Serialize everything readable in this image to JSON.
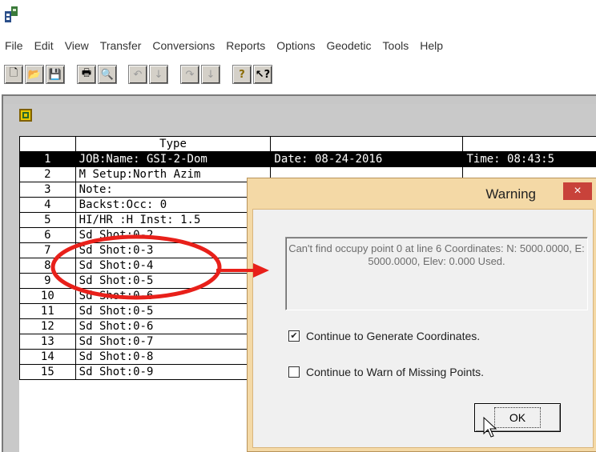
{
  "menu": [
    "File",
    "Edit",
    "View",
    "Transfer",
    "Conversions",
    "Reports",
    "Options",
    "Geodetic",
    "Tools",
    "Help"
  ],
  "toolbar": {
    "buttons": [
      {
        "name": "new-file-icon",
        "glyph": "🗋"
      },
      {
        "name": "open-folder-icon",
        "glyph": "📂"
      },
      {
        "name": "save-icon",
        "glyph": "💾"
      },
      {
        "name": "print-icon",
        "glyph": "🖶"
      },
      {
        "name": "print-preview-icon",
        "glyph": "🔍"
      },
      {
        "name": "undo-icon",
        "glyph": "↶"
      },
      {
        "name": "undo-dropdown-icon",
        "glyph": "↓"
      },
      {
        "name": "redo-icon",
        "glyph": "↷"
      },
      {
        "name": "redo-dropdown-icon",
        "glyph": "↓"
      },
      {
        "name": "help-icon",
        "glyph": "?"
      },
      {
        "name": "context-help-icon",
        "glyph": "↖?"
      }
    ]
  },
  "grid": {
    "headers": [
      "",
      "Type",
      "",
      ""
    ],
    "rows": [
      {
        "num": "1",
        "type": "JOB:Name: GSI-2-Dom",
        "c2": "Date: 08-24-2016",
        "c3": "Time: 08:43:5"
      },
      {
        "num": "2",
        "type": "M Setup:North Azim",
        "c2": "",
        "c3": ""
      },
      {
        "num": "3",
        "type": "Note:",
        "c2": "",
        "c3": ""
      },
      {
        "num": "4",
        "type": "Backst:Occ: 0",
        "c2": "",
        "c3": ""
      },
      {
        "num": "5",
        "type": "HI/HR :H Inst: 1.5",
        "c2": "",
        "c3": ""
      },
      {
        "num": "6",
        "type": "Sd Shot:0-2",
        "c2": "",
        "c3": ""
      },
      {
        "num": "7",
        "type": "Sd Shot:0-3",
        "c2": "",
        "c3": ""
      },
      {
        "num": "8",
        "type": "Sd Shot:0-4",
        "c2": "",
        "c3": ""
      },
      {
        "num": "9",
        "type": "Sd Shot:0-5",
        "c2": "",
        "c3": ""
      },
      {
        "num": "10",
        "type": "Sd Shot:0-6",
        "c2": "",
        "c3": ""
      },
      {
        "num": "11",
        "type": "Sd Shot:0-5",
        "c2": "",
        "c3": ""
      },
      {
        "num": "12",
        "type": "Sd Shot:0-6",
        "c2": "",
        "c3": ""
      },
      {
        "num": "13",
        "type": "Sd Shot:0-7",
        "c2": "",
        "c3": ""
      },
      {
        "num": "14",
        "type": "Sd Shot:0-8",
        "c2": "",
        "c3": ""
      },
      {
        "num": "15",
        "type": "Sd Shot:0-9",
        "c2": "",
        "c3": ""
      }
    ]
  },
  "dialog": {
    "title": "Warning",
    "close_glyph": "×",
    "message": "Can't find occupy point 0 at line 6 Coordinates: N: 5000.0000, E: 5000.0000, Elev: 0.000 Used.",
    "options": [
      {
        "label": "Continue to Generate Coordinates.",
        "checked": true,
        "check_glyph": "✔"
      },
      {
        "label": "Continue to Warn of Missing Points.",
        "checked": false,
        "check_glyph": ""
      }
    ],
    "ok_label": "OK"
  },
  "colors": {
    "dialog_frame": "#f4d9a6",
    "close_button": "#c8423a",
    "annotation": "#e8201a",
    "selected_row": "#000000"
  }
}
